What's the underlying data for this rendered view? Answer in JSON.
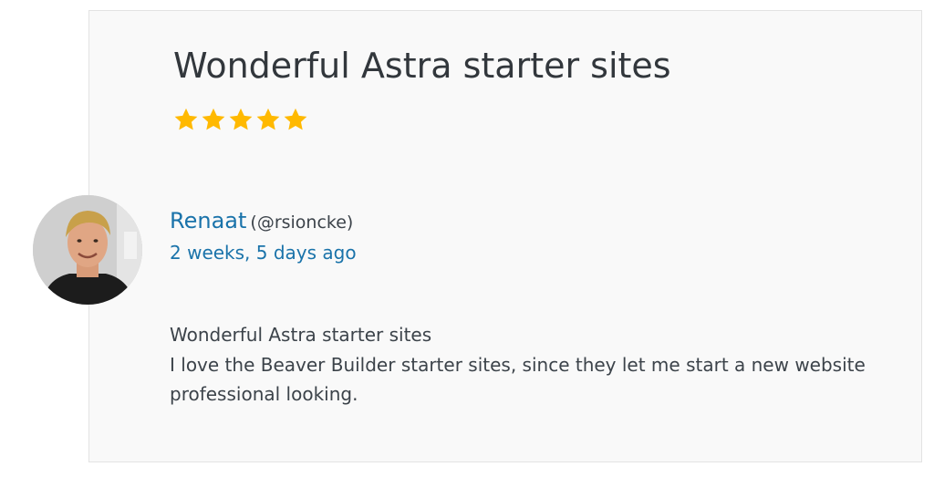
{
  "review": {
    "title": "Wonderful Astra starter sites",
    "rating": {
      "value": 5,
      "max": 5
    },
    "author": {
      "name": "Renaat",
      "handle": "(@rsioncke)"
    },
    "date": "2 weeks, 5 days ago",
    "body_title": "Wonderful Astra starter sites",
    "body_text": "I love the Beaver Builder starter sites, since they let me start a new website professional looking."
  },
  "colors": {
    "link": "#1a73aa",
    "star": "#ffb900",
    "text": "#3c434a",
    "card_bg": "#f9f9f9"
  },
  "icons": {
    "star": "star-filled-icon"
  }
}
